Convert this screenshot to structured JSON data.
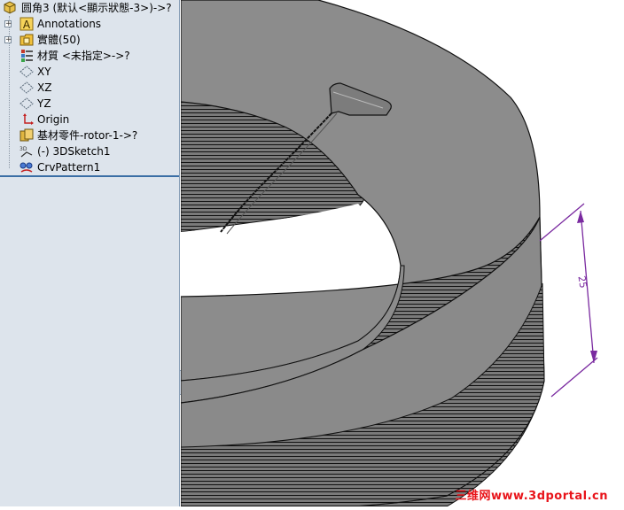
{
  "feature_tree": {
    "root": {
      "label": "圆角3 (默认<顯示狀態-3>)->?",
      "icon": "part-icon"
    },
    "items": [
      {
        "label": "Annotations",
        "icon": "annotations-icon",
        "expandable": true
      },
      {
        "label": "實體(50)",
        "icon": "solid-bodies-folder-icon",
        "expandable": true
      },
      {
        "label": "材質 <未指定>->?",
        "icon": "material-icon",
        "expandable": false
      },
      {
        "label": "XY",
        "icon": "plane-icon",
        "expandable": false
      },
      {
        "label": "XZ",
        "icon": "plane-icon",
        "expandable": false
      },
      {
        "label": "YZ",
        "icon": "plane-icon",
        "expandable": false
      },
      {
        "label": "Origin",
        "icon": "origin-icon",
        "expandable": false
      },
      {
        "label": "基材零件-rotor-1->?",
        "icon": "base-part-icon",
        "expandable": false
      },
      {
        "label": "(-) 3DSketch1",
        "icon": "3d-sketch-icon",
        "expandable": false
      },
      {
        "label": "CrvPattern1",
        "icon": "curve-pattern-icon",
        "expandable": false
      }
    ]
  },
  "viewport": {
    "dimension_value": "25",
    "dimension_color": "#7a2aa0",
    "model_face_color": "#8a8a8a",
    "model_edge_color": "#111111"
  },
  "watermark": {
    "text": "三维网www.3dportal.cn"
  },
  "colors": {
    "tree_bg": "#dde4ec",
    "rollback_bar": "#3a6ea5"
  }
}
